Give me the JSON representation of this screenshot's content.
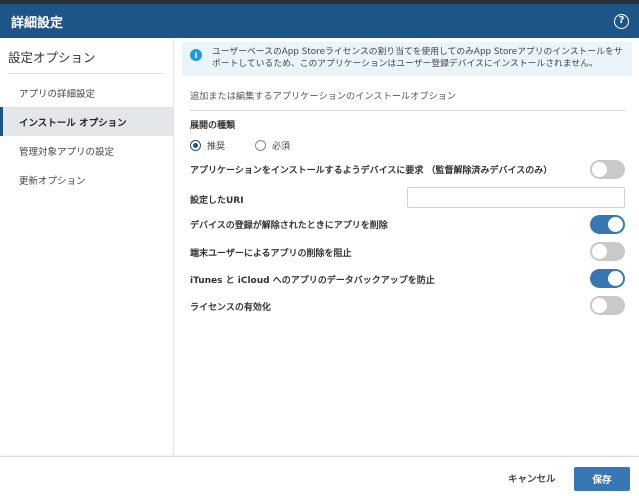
{
  "dialog": {
    "title": "詳細設定",
    "help_icon": "help-circle-icon",
    "help_glyph": "?"
  },
  "sidebar": {
    "header": "設定オプション",
    "items": [
      {
        "label": "アプリの詳細設定",
        "active": false
      },
      {
        "label": "インストール オプション",
        "active": true
      },
      {
        "label": "管理対象アプリの設定",
        "active": false
      },
      {
        "label": "更新オプション",
        "active": false
      }
    ]
  },
  "main": {
    "banner": {
      "icon": "info-icon",
      "glyph": "i",
      "text": "ユーザーベースのApp Storeライセンスの割り当てを使用してのみApp Storeアプリのインストールをサポートしているため、このアプリケーションはユーザー登録デバイスにインストールされません。"
    },
    "subtitle": "追加または編集するアプリケーションのインストールオプション",
    "deploy_type": {
      "label": "展開の種類",
      "options": [
        {
          "label": "推奨",
          "checked": true
        },
        {
          "label": "必須",
          "checked": false
        }
      ]
    },
    "settings": {
      "request_install": {
        "label": "アプリケーションをインストールするようデバイスに要求 （監督解除済みデバイスのみ）",
        "on": false
      },
      "uri": {
        "label": "設定したURI",
        "value": "",
        "placeholder": ""
      },
      "remove_on_unenroll": {
        "label": "デバイスの登録が解除されたときにアプリを削除",
        "on": true
      },
      "prevent_user_removal": {
        "label": "端末ユーザーによるアプリの削除を阻止",
        "on": false
      },
      "prevent_backup": {
        "label": "iTunes と iCloud へのアプリのデータバックアップを防止",
        "on": true
      },
      "enable_license": {
        "label": "ライセンスの有効化",
        "on": false
      }
    }
  },
  "footer": {
    "cancel_label": "キャンセル",
    "save_label": "保存"
  },
  "colors": {
    "header_bg": "#1d5589",
    "accent": "#3677b4",
    "toggle_off": "#c9c9c9",
    "banner_bg": "#eaf4fb",
    "info_icon": "#1e9be0"
  }
}
